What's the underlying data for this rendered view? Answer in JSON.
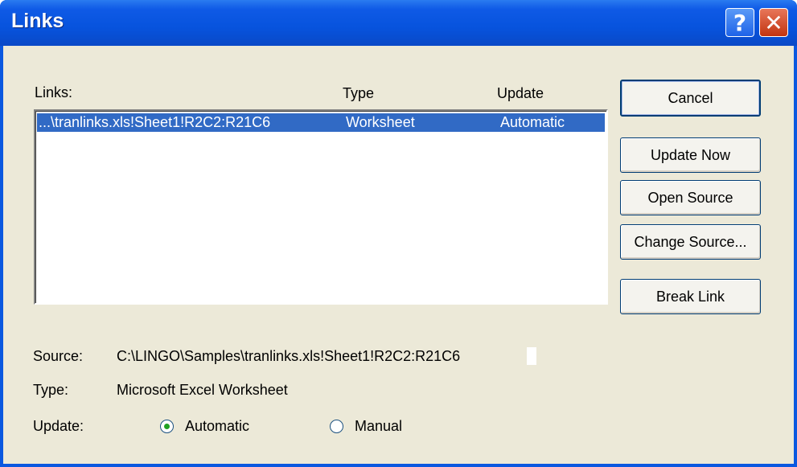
{
  "window": {
    "title": "Links"
  },
  "titlebar": {
    "help_glyph": "?",
    "close_glyph": "✕"
  },
  "list": {
    "headers": {
      "links": "Links:",
      "type": "Type",
      "update": "Update"
    },
    "rows": [
      {
        "link": "...\\tranlinks.xls!Sheet1!R2C2:R21C6",
        "type": "Worksheet",
        "update": "Automatic",
        "selected": true
      }
    ]
  },
  "buttons": {
    "cancel": "Cancel",
    "update_now": "Update Now",
    "open_source": "Open Source",
    "change_source": "Change Source...",
    "break_link": "Break Link"
  },
  "details": {
    "source_label": "Source:",
    "source_value": "C:\\LINGO\\Samples\\tranlinks.xls!Sheet1!R2C2:R21C6",
    "type_label": "Type:",
    "type_value": "Microsoft Excel Worksheet",
    "update_label": "Update:",
    "update_options": [
      {
        "label": "Automatic",
        "checked": true
      },
      {
        "label": "Manual",
        "checked": false
      }
    ]
  },
  "colors": {
    "titlebar": "#0753dd",
    "selection": "#316ac5",
    "dialog_bg": "#ece9d8"
  },
  "icons": [
    "help-icon",
    "close-icon"
  ]
}
